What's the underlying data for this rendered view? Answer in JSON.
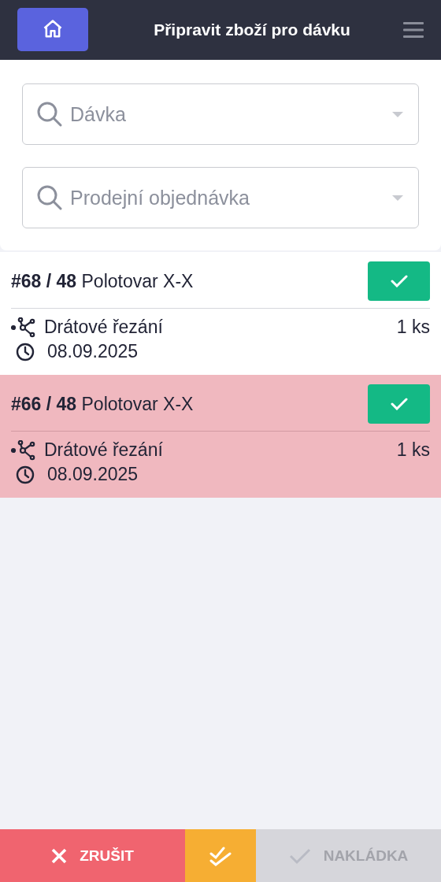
{
  "header": {
    "title": "Připravit zboží pro dávku"
  },
  "filters": [
    {
      "placeholder": "Dávka"
    },
    {
      "placeholder": "Prodejní objednávka"
    }
  ],
  "items": [
    {
      "title": "**#68 / 48** Polotovar X-X",
      "operation": "Drátové řezání",
      "quantity": "1 ks",
      "date": "08.09.2025",
      "highlighted": false
    },
    {
      "title": "**#66 / 48** Polotovar X-X",
      "operation": "Drátové řezání",
      "quantity": "1 ks",
      "date": "08.09.2025",
      "highlighted": true
    }
  ],
  "footer": {
    "cancel": {
      "label": "ZRUŠIT"
    },
    "confirm": {
      "label": "NAKLÁDKA",
      "disabled": true
    }
  }
}
